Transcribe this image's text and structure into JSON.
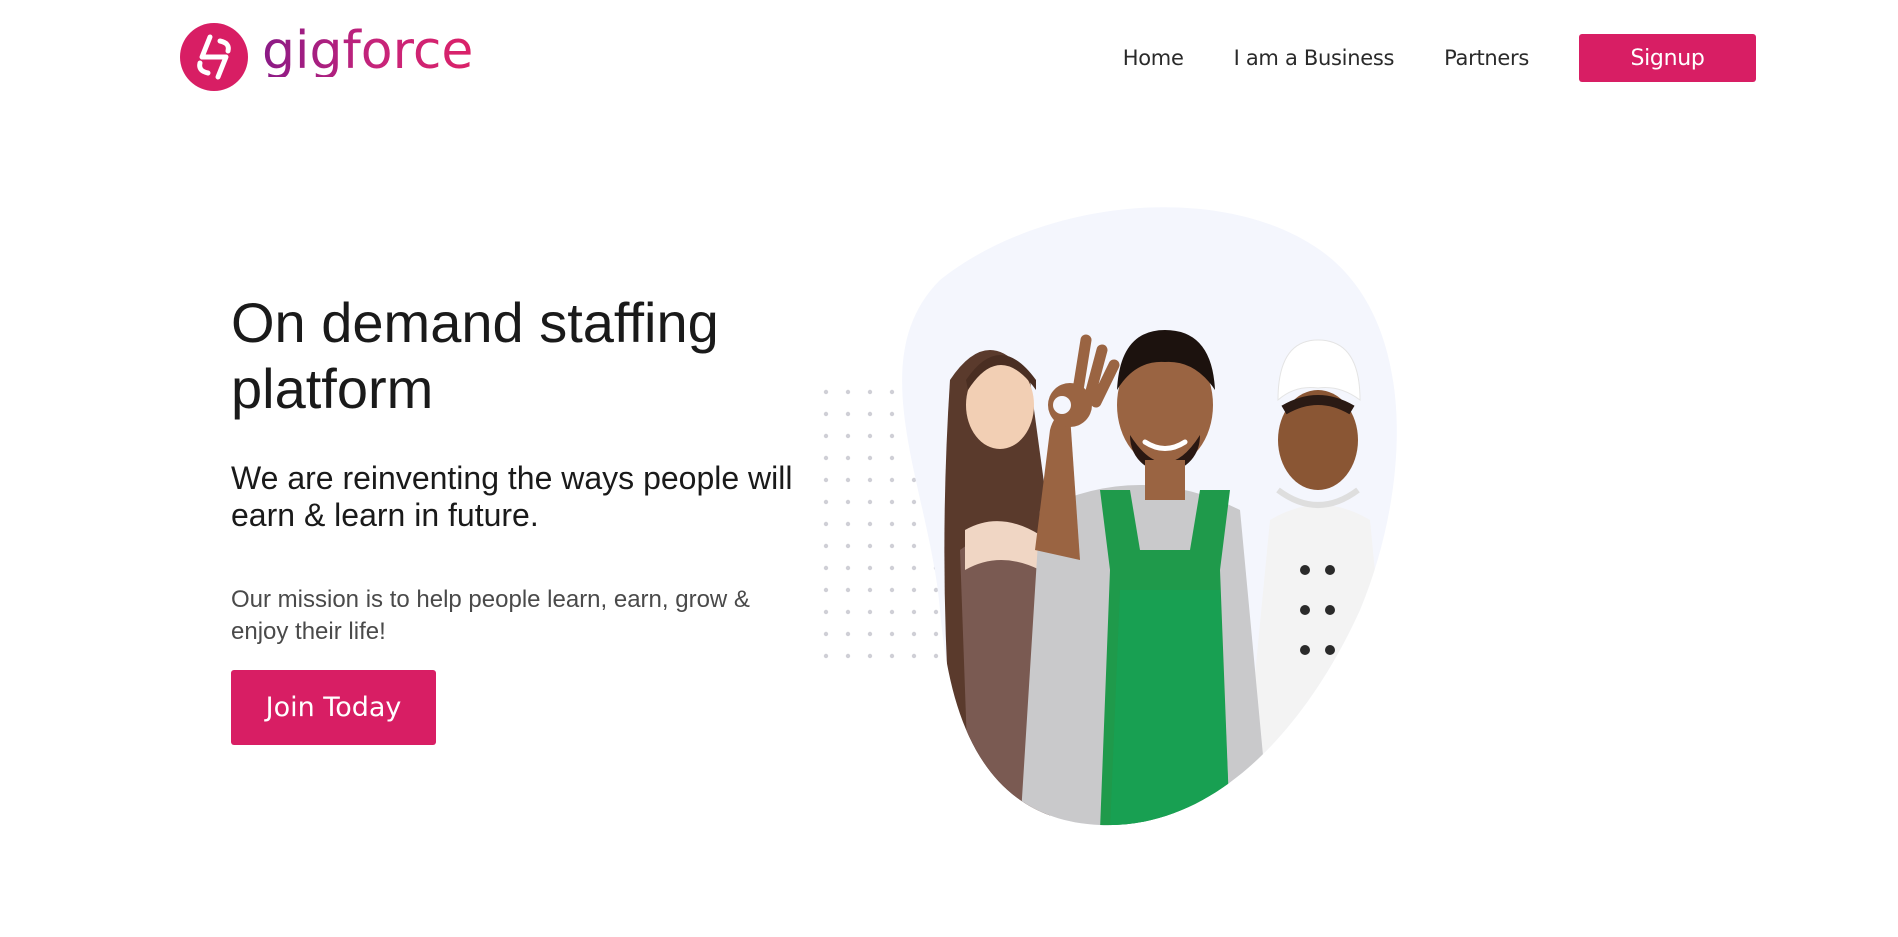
{
  "brand": {
    "name": "gigforce",
    "primary_color": "#d81e64",
    "gradient_start": "#8a1a86",
    "gradient_end": "#db2268"
  },
  "nav": {
    "items": [
      {
        "label": "Home"
      },
      {
        "label": "I am a Business"
      },
      {
        "label": "Partners"
      }
    ],
    "signup_label": "Signup"
  },
  "hero": {
    "title": "On demand staffing platform",
    "subtitle": "We are reinventing the ways people will earn & learn in future.",
    "mission": "Our mission is to help people learn, earn, grow & enjoy their life!",
    "cta_label": "Join Today",
    "image_description_icon": "workers-illustration"
  }
}
